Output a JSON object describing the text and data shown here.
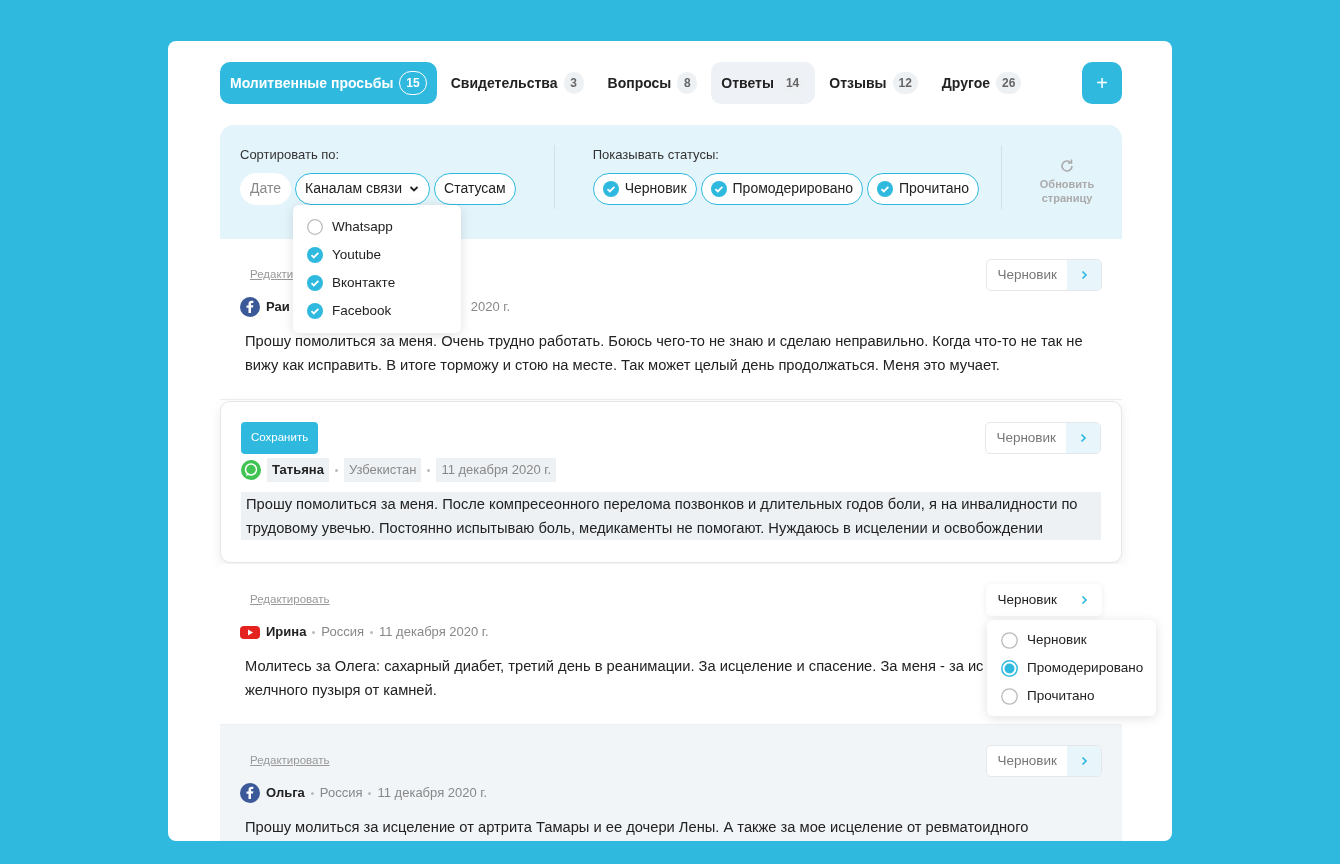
{
  "tabs": [
    {
      "label": "Молитвенные просьбы",
      "count": "15",
      "selected": true,
      "highlighted": false
    },
    {
      "label": "Свидетельства",
      "count": "3",
      "selected": false,
      "highlighted": false
    },
    {
      "label": "Вопросы",
      "count": "8",
      "selected": false,
      "highlighted": false
    },
    {
      "label": "Ответы",
      "count": "14",
      "selected": false,
      "highlighted": true
    },
    {
      "label": "Отзывы",
      "count": "12",
      "selected": false,
      "highlighted": false
    },
    {
      "label": "Другое",
      "count": "26",
      "selected": false,
      "highlighted": false
    }
  ],
  "add_button": {
    "label": "+"
  },
  "sort": {
    "label": "Сортировать по:",
    "options": [
      {
        "label": "Дате",
        "selected": false
      },
      {
        "label": "Каналам связи",
        "selected": true,
        "expanded": true,
        "menu": [
          {
            "label": "Whatsapp",
            "checked": false
          },
          {
            "label": "Youtube",
            "checked": true
          },
          {
            "label": "Вконтакте",
            "checked": true
          },
          {
            "label": "Facebook",
            "checked": true
          }
        ]
      },
      {
        "label": "Статусам",
        "selected": true
      }
    ]
  },
  "status_filter": {
    "label": "Показывать статусы:",
    "options": [
      {
        "label": "Черновик",
        "checked": true
      },
      {
        "label": "Промодерировано",
        "checked": true
      },
      {
        "label": "Прочитано",
        "checked": true
      }
    ]
  },
  "refresh": {
    "label": "Обновить страницу"
  },
  "posts": [
    {
      "editing": false,
      "highlighted": false,
      "edit_label": "Редакти",
      "kind": "facebook",
      "author": "Раи",
      "date": "2020 г.",
      "text": "Прошу помолиться за меня. Очень трудно работать. Боюсь чего-то не знаю и сделаю неправильно. Когда что-то не так не вижу как исправить. В итоге торможу и стою на месте. Так может целый день продолжаться. Меня это мучает.",
      "status": "Черновик"
    },
    {
      "editing": true,
      "highlighted": false,
      "save_label": "Сохранить",
      "kind": "whatsapp",
      "author": "Татьяна",
      "country": "Узбекистан",
      "date": "11 декабря 2020 г.",
      "text": "Прошу помолиться за меня. После компресеонного перелома позвонков и длительных годов боли, я на инвалидности по трудовому увечью. Постоянно испытываю боль, медикаменты не помогают. Нуждаюсь в исцелении и освобождении",
      "status": "Черновик"
    },
    {
      "editing": false,
      "highlighted": false,
      "edit_label": "Редактировать",
      "kind": "youtube",
      "author": "Ирина",
      "country": "Россия",
      "date": "11 декабря 2020 г.",
      "text": "Молитесь за Олега: сахарный диабет, третий день в реанимации. За исцеление и спасение. За меня - за ис",
      "text_2": "желчного пузыря от камней.",
      "status": "Черновик",
      "status_menu": [
        {
          "label": "Черновик",
          "selected": false
        },
        {
          "label": "Промодерировано",
          "selected": true
        },
        {
          "label": "Прочитано",
          "selected": false
        }
      ]
    },
    {
      "editing": false,
      "highlighted": true,
      "edit_label": "Редактировать",
      "kind": "facebook",
      "author": "Ольга",
      "country": "Россия",
      "date": "11 декабря 2020 г.",
      "text": "Прошу молиться за исцеление от артрита Тамары и ее дочери Лены. А также за мое исцеление от ревматоидного",
      "status": "Черновик"
    }
  ]
}
